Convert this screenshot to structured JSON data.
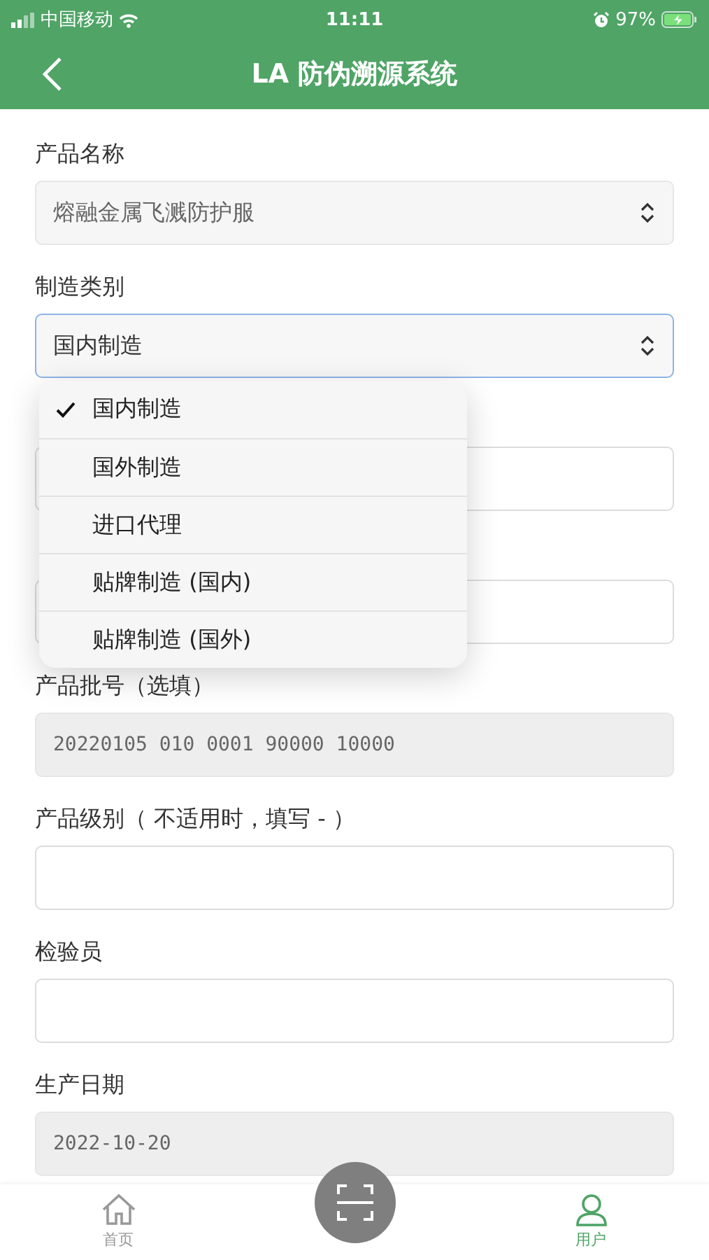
{
  "status_bar": {
    "carrier": "中国移动",
    "time": "11:11",
    "battery": "97%"
  },
  "nav": {
    "title": "LA 防伪溯源系统"
  },
  "fields": [
    {
      "kind": "select",
      "label": "产品名称",
      "value": "熔融金属飞溅防护服",
      "disabled": true,
      "focused": false
    },
    {
      "kind": "select",
      "label": "制造类别",
      "value": "国内制造",
      "disabled": false,
      "focused": true,
      "menu": [
        {
          "label": "国内制造",
          "selected": true
        },
        {
          "label": "国外制造",
          "selected": false
        },
        {
          "label": "进口代理",
          "selected": false
        },
        {
          "label": "贴牌制造 (国内)",
          "selected": false
        },
        {
          "label": "贴牌制造 (国外)",
          "selected": false
        }
      ]
    },
    {
      "kind": "input",
      "disabled": false,
      "focused": false
    },
    {
      "kind": "input",
      "disabled": false,
      "focused": false
    },
    {
      "kind": "input",
      "label": "产品批号（选填）",
      "value": "20220105 010 0001 90000 10000",
      "disabled": true,
      "focused": false
    },
    {
      "kind": "input",
      "label": "产品级别（ 不适用时，填写 - ）",
      "disabled": false,
      "focused": false
    },
    {
      "kind": "input",
      "label": "检验员",
      "disabled": false,
      "focused": false
    },
    {
      "kind": "input",
      "label": "生产日期",
      "value": "2022-10-20",
      "disabled": true,
      "focused": false
    }
  ],
  "tab_bar": [
    {
      "kind": "home",
      "label": "首页",
      "selected": false
    },
    {
      "kind": "scan",
      "selected": false
    },
    {
      "kind": "user",
      "label": "用户",
      "selected": true
    }
  ]
}
